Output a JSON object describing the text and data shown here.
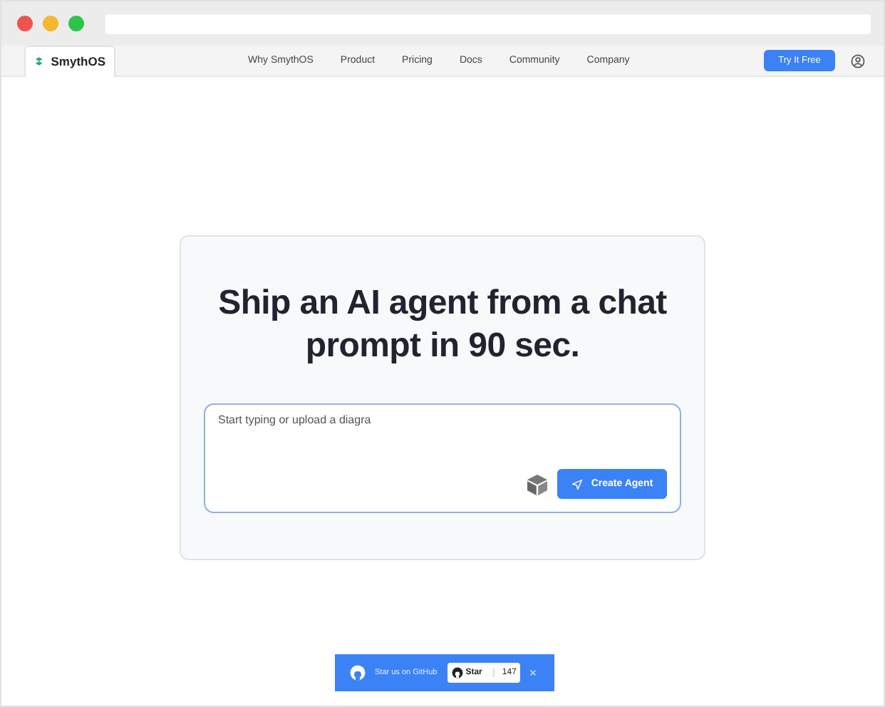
{
  "browser": {
    "tab_title": "SmythOS"
  },
  "nav": {
    "links": [
      "Why SmythOS",
      "Product",
      "Pricing",
      "Docs",
      "Community",
      "Company"
    ],
    "cta": "Try It Free"
  },
  "hero": {
    "headline": "Ship an AI agent from a chat prompt in 90 sec.",
    "prompt": {
      "placeholder": "Start typing or upload a diagra"
    },
    "button": "Create Agent"
  },
  "github_banner": {
    "text": "Star us on GitHub",
    "star_label": "Star",
    "star_count": "147",
    "close": "×"
  }
}
